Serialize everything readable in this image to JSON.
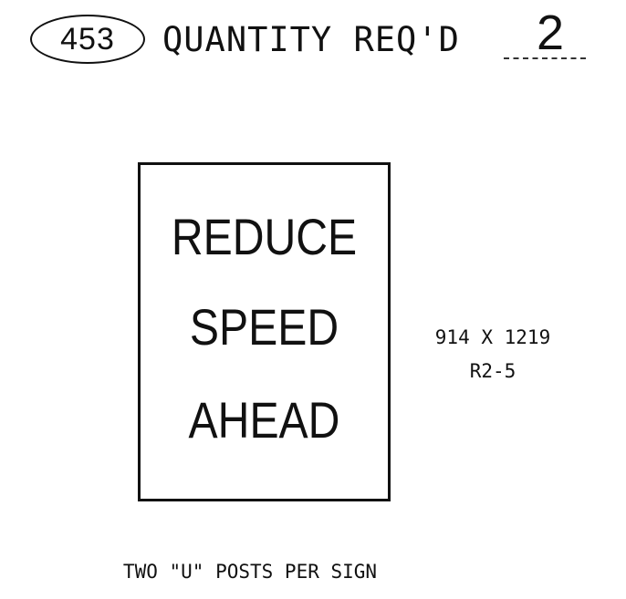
{
  "header": {
    "item_number": "453",
    "quantity_label": "QUANTITY REQ'D",
    "quantity_value": "2"
  },
  "sign": {
    "lines": [
      "REDUCE",
      "SPEED",
      "AHEAD"
    ]
  },
  "specs": {
    "size": "914 X 1219",
    "code": "R2-5"
  },
  "note": "TWO \"U\" POSTS PER SIGN"
}
